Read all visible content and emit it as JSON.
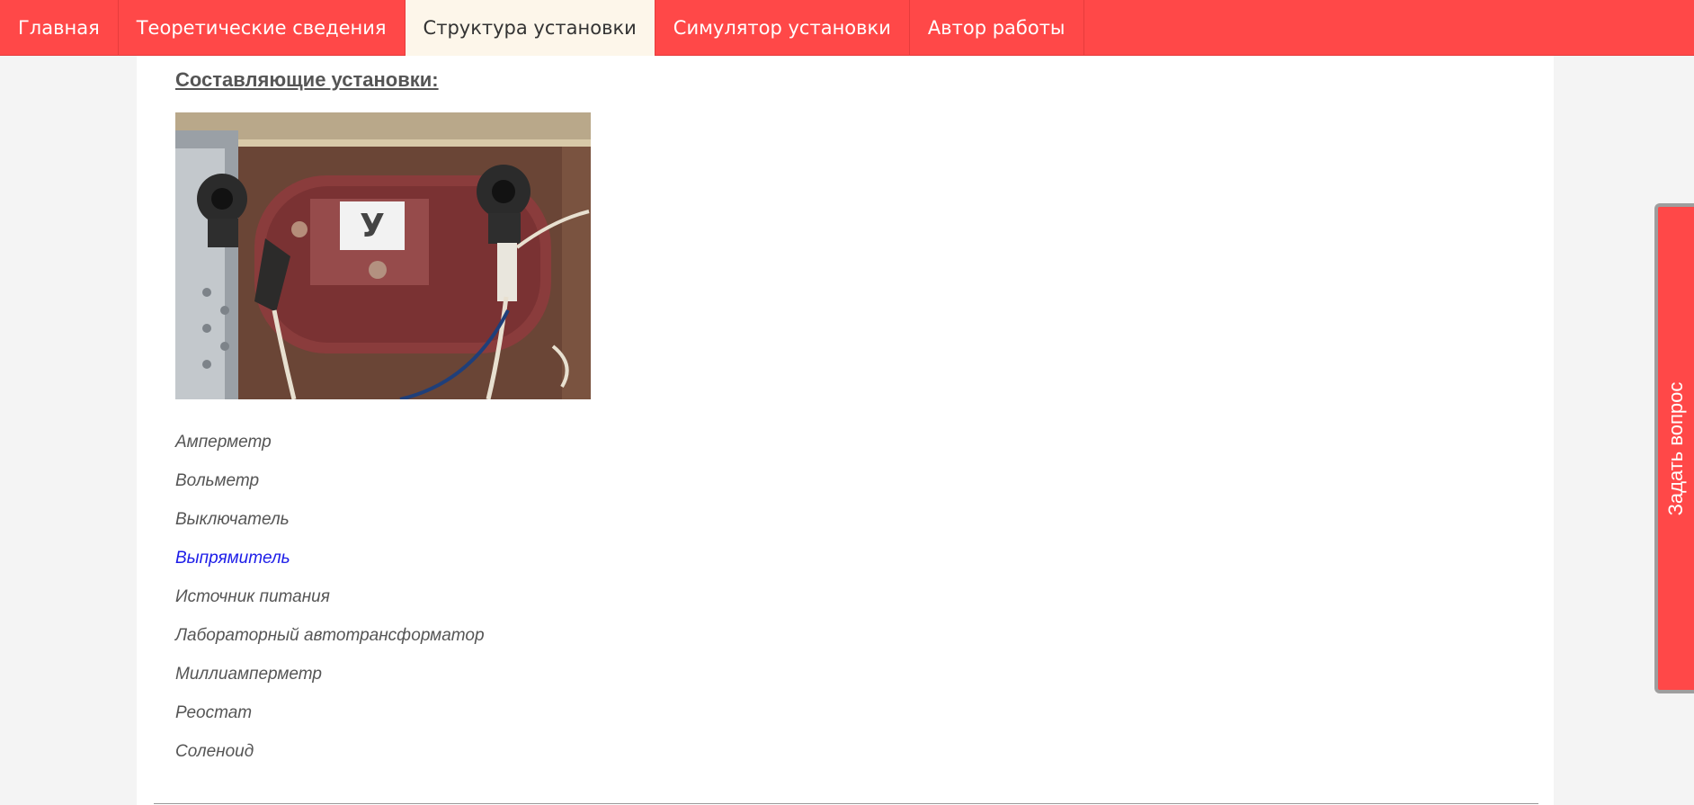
{
  "nav": {
    "items": [
      {
        "label": "Главная",
        "active": false
      },
      {
        "label": "Теоретические сведения",
        "active": false
      },
      {
        "label": "Структура установки",
        "active": true
      },
      {
        "label": "Симулятор установки",
        "active": false
      },
      {
        "label": "Автор работы",
        "active": false
      }
    ]
  },
  "main": {
    "section_title": "Составляющие установки:",
    "photo_sticker_letter": "У",
    "components": [
      {
        "label": "Амперметр",
        "link": false
      },
      {
        "label": "Вольметр",
        "link": false
      },
      {
        "label": "Выключатель",
        "link": false
      },
      {
        "label": "Выпрямитель",
        "link": true
      },
      {
        "label": "Источник питания",
        "link": false
      },
      {
        "label": "Лабораторный автотрансформатор",
        "link": false
      },
      {
        "label": "Миллиамперметр",
        "link": false
      },
      {
        "label": "Реостат",
        "link": false
      },
      {
        "label": "Соленоид",
        "link": false
      }
    ]
  },
  "ask_tab": {
    "label": "Задать вопрос"
  },
  "colors": {
    "brand_red": "#ff4848",
    "active_tab_bg": "#fdf6ea",
    "link_blue": "#1c1ce8",
    "text_gray": "#555555"
  }
}
